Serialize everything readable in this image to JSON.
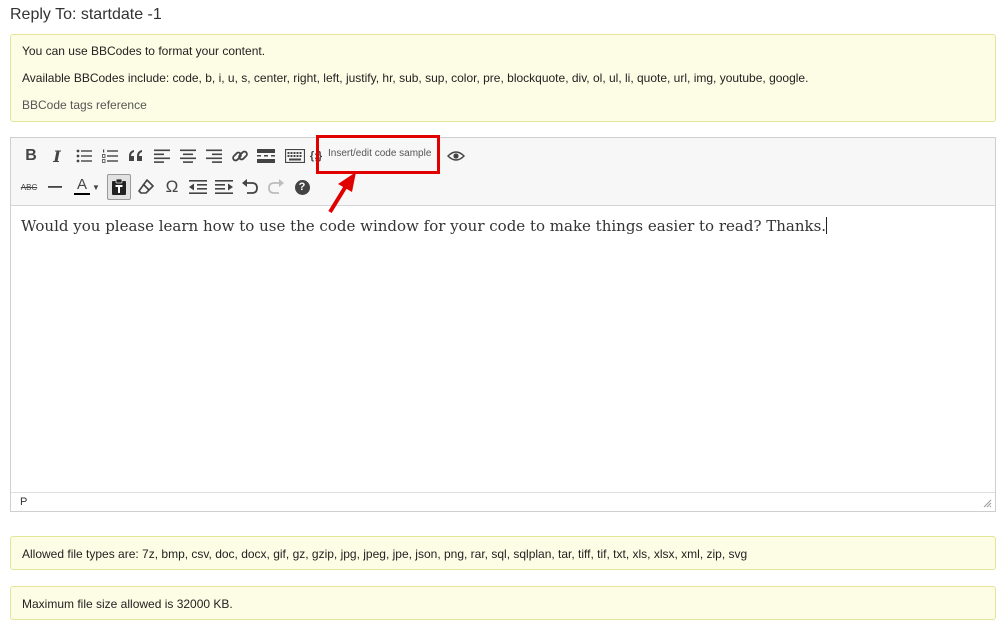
{
  "page": {
    "title": "Reply To: startdate -1"
  },
  "bbcode_notice": {
    "line1": "You can use BBCodes to format your content.",
    "line2": "Available BBCodes include: code, b, i, u, s, center, right, left, justify, hr, sub, sup, color, pre, blockquote, div, ol, ul, li, quote, url, img, youtube, google.",
    "reference_link": "BBCode tags reference"
  },
  "toolbar": {
    "row1": [
      {
        "name": "bold-button",
        "icon": "bold-icon",
        "label": "B"
      },
      {
        "name": "italic-button",
        "icon": "italic-icon",
        "label": "I"
      },
      {
        "name": "bullet-list-button",
        "icon": "bullet-list-icon"
      },
      {
        "name": "numbered-list-button",
        "icon": "numbered-list-icon"
      },
      {
        "name": "blockquote-button",
        "icon": "quote-icon"
      },
      {
        "name": "align-left-button",
        "icon": "align-left-icon"
      },
      {
        "name": "align-center-button",
        "icon": "align-center-icon"
      },
      {
        "name": "align-right-button",
        "icon": "align-right-icon"
      },
      {
        "name": "link-button",
        "icon": "link-icon"
      },
      {
        "name": "read-more-button",
        "icon": "read-more-icon"
      },
      {
        "name": "toolbar-toggle-button",
        "icon": "keyboard-icon"
      },
      {
        "name": "code-sample-button",
        "icon": "code-braces-icon",
        "tooltip": "Insert/edit code sample"
      },
      {
        "name": "preview-button",
        "icon": "eye-icon"
      }
    ],
    "row2": [
      {
        "name": "strikethrough-button",
        "icon": "strikethrough-icon",
        "label": "ABC"
      },
      {
        "name": "horizontal-line-button",
        "icon": "horizontal-line-icon"
      },
      {
        "name": "text-color-button",
        "icon": "text-color-icon",
        "label": "A"
      },
      {
        "name": "paste-text-button",
        "icon": "paste-text-icon",
        "pressed": true
      },
      {
        "name": "clear-formatting-button",
        "icon": "eraser-icon"
      },
      {
        "name": "special-character-button",
        "icon": "omega-icon",
        "label": "Ω"
      },
      {
        "name": "outdent-button",
        "icon": "outdent-icon"
      },
      {
        "name": "indent-button",
        "icon": "indent-icon"
      },
      {
        "name": "undo-button",
        "icon": "undo-icon"
      },
      {
        "name": "redo-button",
        "icon": "redo-icon"
      },
      {
        "name": "help-button",
        "icon": "help-icon",
        "label": "?"
      }
    ]
  },
  "editor": {
    "content": "Would you please learn how to use the code window for your code to make things easier to read?  Thanks.",
    "status_path": "P"
  },
  "annotation": {
    "color": "#e00000"
  },
  "allowed_files": {
    "text": "Allowed file types are: 7z, bmp, csv, doc, docx, gif, gz, gzip, jpg, jpeg, jpe, json, png, rar, sql, sqlplan, tar, tiff, tif, txt, xls, xlsx, xml, zip, svg"
  },
  "max_size": {
    "text": "Maximum file size allowed is 32000 KB."
  }
}
